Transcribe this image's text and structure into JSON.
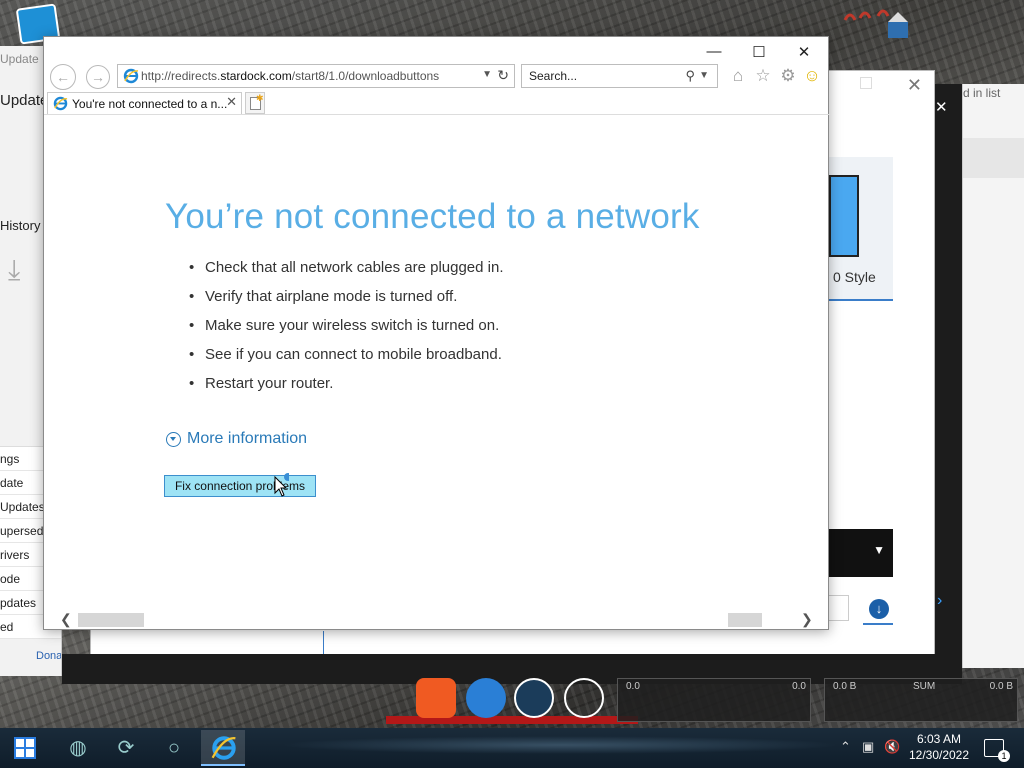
{
  "desktop": {
    "background": "rocky-wallpaper"
  },
  "bg_app": {
    "title": "Update M",
    "header": "Update",
    "history": "History",
    "options": [
      "ngs",
      "date",
      "Updates",
      "upersede",
      "rivers",
      "ode",
      "pdates",
      "ed"
    ],
    "donate": "Donat"
  },
  "bg_dialog": {
    "tile_label": "0 Style",
    "right_text": "d in list"
  },
  "ie": {
    "url_prefix": "http://redirects.",
    "url_domain": "stardock.com",
    "url_suffix": "/start8/1.0/downloadbuttons",
    "search_placeholder": "Search...",
    "tab_title": "You're not connected to a n...",
    "page": {
      "title": "You’re not connected to a network",
      "bullets": [
        "Check that all network cables are plugged in.",
        "Verify that airplane mode is turned off.",
        "Make sure your wireless switch is turned on.",
        "See if you can connect to mobile broadband.",
        "Restart your router."
      ],
      "more_info": "More information",
      "fix_button": "Fix connection problems"
    }
  },
  "widgets": {
    "net_left": "0.0",
    "net_right": "0.0",
    "sum_left": "0.0 B",
    "sum_label": "SUM",
    "sum_right": "0.0 B"
  },
  "taskbar": {
    "time": "6:03 AM",
    "date": "12/30/2022",
    "notification_count": "1"
  },
  "colors": {
    "title_blue": "#59aee5",
    "link_blue": "#2a7ab8",
    "button_fill": "#9ee3f5"
  }
}
